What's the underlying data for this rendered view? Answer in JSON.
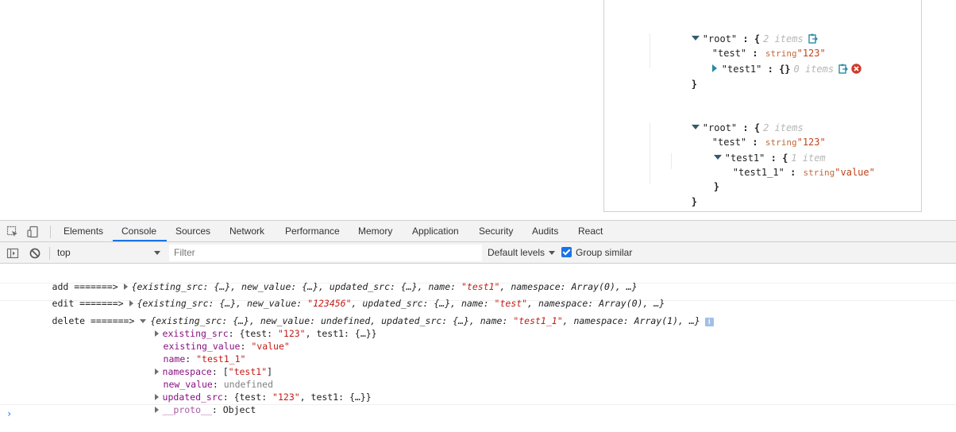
{
  "json_viewer": {
    "tree1": {
      "root_key": "\"root\"",
      "colon": ":",
      "open": "{",
      "close": "}",
      "count": "2 items",
      "test_key": "\"test\"",
      "test_type": "string",
      "test_value": "\"123\"",
      "test1_key": "\"test1\"",
      "test1_value": "{}",
      "test1_count": "0 items"
    },
    "tree2": {
      "root_key": "\"root\"",
      "colon": ":",
      "open": "{",
      "close": "}",
      "count": "2 items",
      "test_key": "\"test\"",
      "test_type": "string",
      "test_value": "\"123\"",
      "test1_key": "\"test1\"",
      "test1_open": "{",
      "test1_close": "}",
      "test1_count": "1 item",
      "test1_1_key": "\"test1_1\"",
      "test1_1_type": "string",
      "test1_1_value": "\"value\""
    }
  },
  "devtools": {
    "tabs": [
      "Elements",
      "Console",
      "Sources",
      "Network",
      "Performance",
      "Memory",
      "Application",
      "Security",
      "Audits",
      "React"
    ],
    "active_tab": "Console",
    "context": "top",
    "filter_placeholder": "Filter",
    "levels": "Default levels",
    "group_similar": "Group similar",
    "accent": "#1a73e8"
  },
  "console": {
    "line1": {
      "label": "add =======>",
      "open": "{existing_src: {…}, new_value: {…}, updated_src: {…}, name: ",
      "name": "\"test1\"",
      "rest": ", namespace: Array(0), …}"
    },
    "line2": {
      "label": "edit =======>",
      "open": "{existing_src: {…}, new_value: ",
      "new_value": "\"123456\"",
      "mid": ", updated_src: {…}, name: ",
      "name": "\"test\"",
      "rest": ", namespace: Array(0), …}"
    },
    "line3": {
      "label": "delete =======>",
      "open": "{existing_src: {…}, new_value: undefined, updated_src: {…}, name: ",
      "name": "\"test1_1\"",
      "rest": ", namespace: Array(1), …}",
      "info": "i",
      "props": {
        "existing_src_key": "existing_src",
        "existing_src_a": "{test: ",
        "existing_src_str": "\"123\"",
        "existing_src_b": ", test1: {…}}",
        "existing_value_key": "existing_value",
        "existing_value": "\"value\"",
        "name_key": "name",
        "name_value": "\"test1_1\"",
        "namespace_key": "namespace",
        "namespace_a": "[",
        "namespace_str": "\"test1\"",
        "namespace_b": "]",
        "new_value_key": "new_value",
        "new_value": "undefined",
        "updated_src_key": "updated_src",
        "updated_src_a": "{test: ",
        "updated_src_str": "\"123\"",
        "updated_src_b": ", test1: {…}}",
        "proto_key": "__proto__",
        "proto_value": "Object"
      }
    },
    "prompt": "›"
  }
}
